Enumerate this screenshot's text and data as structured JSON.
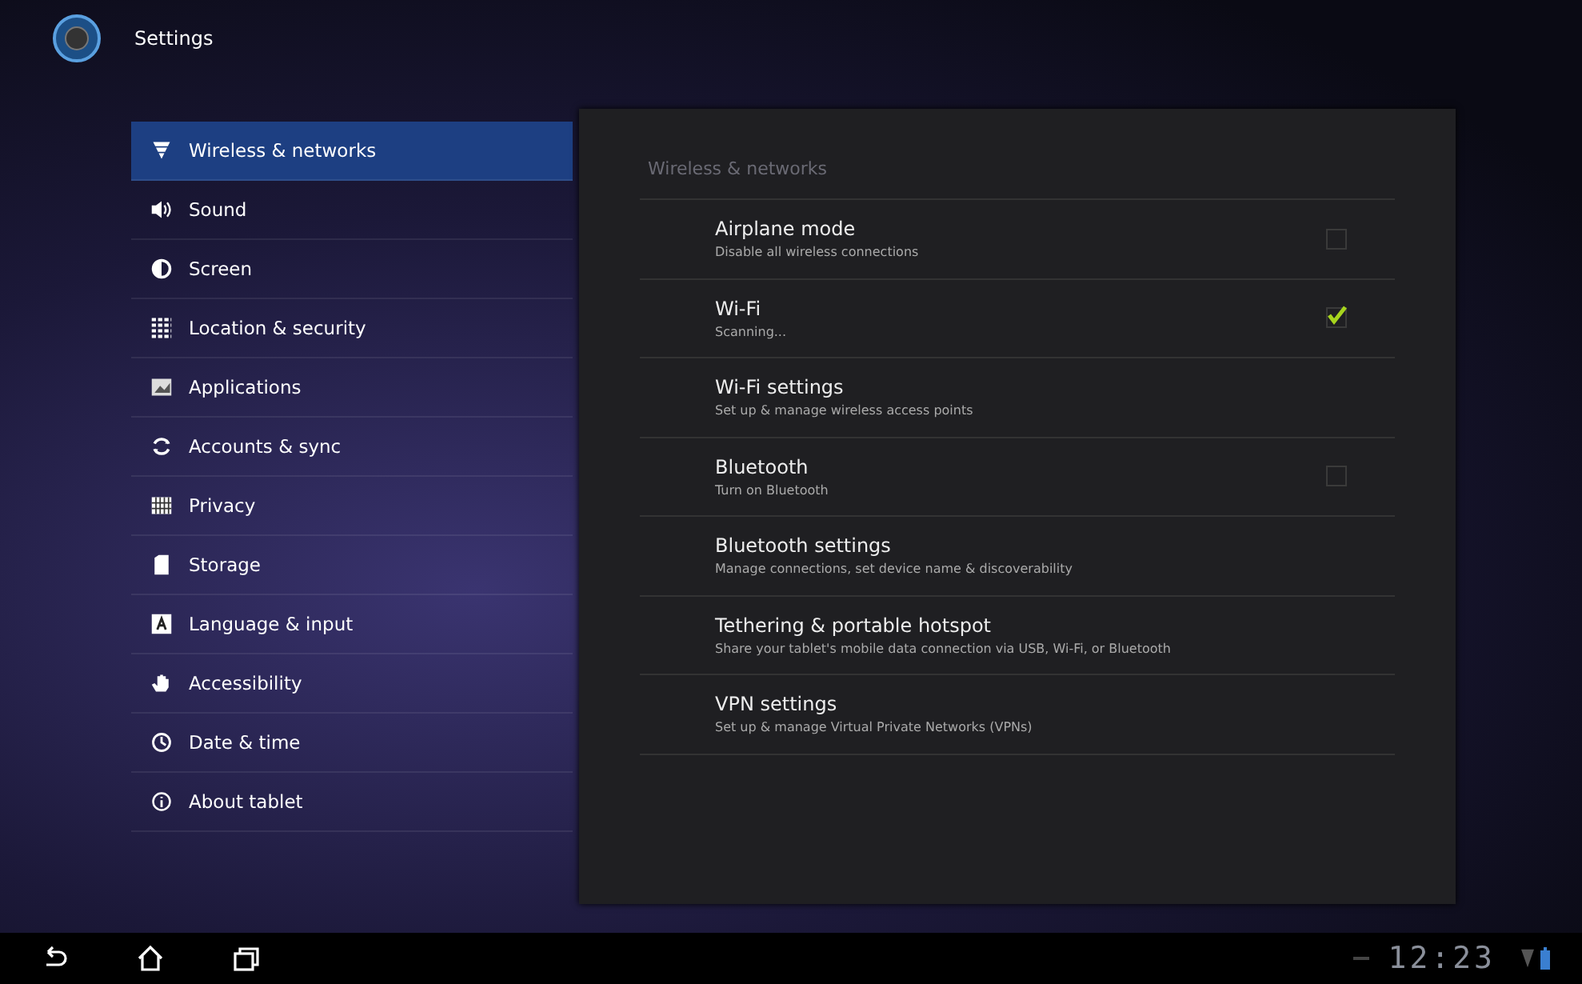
{
  "app_bar": {
    "title": "Settings"
  },
  "sidebar": {
    "items": [
      {
        "label": "Wireless & networks",
        "selected": true
      },
      {
        "label": "Sound",
        "selected": false
      },
      {
        "label": "Screen",
        "selected": false
      },
      {
        "label": "Location & security",
        "selected": false
      },
      {
        "label": "Applications",
        "selected": false
      },
      {
        "label": "Accounts & sync",
        "selected": false
      },
      {
        "label": "Privacy",
        "selected": false
      },
      {
        "label": "Storage",
        "selected": false
      },
      {
        "label": "Language & input",
        "selected": false
      },
      {
        "label": "Accessibility",
        "selected": false
      },
      {
        "label": "Date & time",
        "selected": false
      },
      {
        "label": "About tablet",
        "selected": false
      }
    ]
  },
  "panel": {
    "title": "Wireless & networks",
    "items": [
      {
        "kind": "checkbox",
        "title": "Airplane mode",
        "summary": "Disable all wireless connections",
        "checked": false
      },
      {
        "kind": "checkbox",
        "title": "Wi-Fi",
        "summary": "Scanning...",
        "checked": true
      },
      {
        "kind": "link",
        "title": "Wi-Fi settings",
        "summary": "Set up & manage wireless access points"
      },
      {
        "kind": "checkbox",
        "title": "Bluetooth",
        "summary": "Turn on Bluetooth",
        "checked": false
      },
      {
        "kind": "link",
        "title": "Bluetooth settings",
        "summary": "Manage connections, set device name & discoverability"
      },
      {
        "kind": "link",
        "title": "Tethering & portable hotspot",
        "summary": "Share your tablet's mobile data connection via USB, Wi-Fi, or Bluetooth"
      },
      {
        "kind": "link",
        "title": "VPN settings",
        "summary": "Set up & manage Virtual Private Networks (VPNs)"
      }
    ]
  },
  "status_bar": {
    "time": "12:23"
  }
}
